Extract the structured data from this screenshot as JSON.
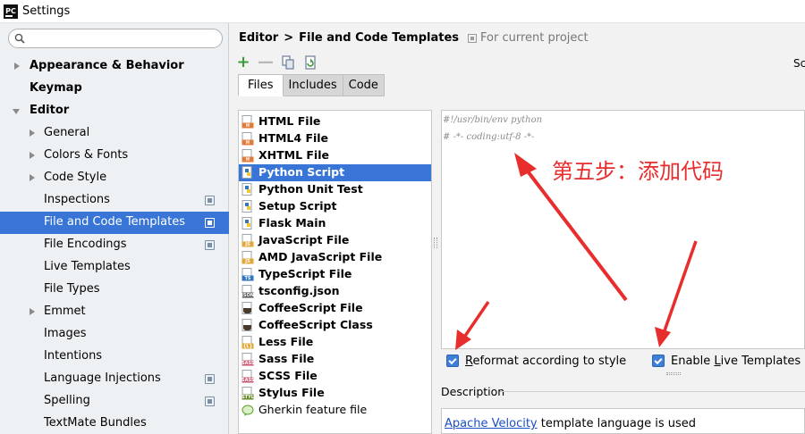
{
  "window": {
    "title": "Settings",
    "app_icon_text": "PC"
  },
  "search": {
    "placeholder": "",
    "value": ""
  },
  "sidebar": {
    "items": [
      {
        "label": "Appearance & Behavior",
        "bold": true
      },
      {
        "label": "Keymap",
        "bold": true
      },
      {
        "label": "Editor",
        "bold": true
      },
      {
        "label": "General"
      },
      {
        "label": "Colors & Fonts"
      },
      {
        "label": "Code Style"
      },
      {
        "label": "Inspections"
      },
      {
        "label": "File and Code Templates",
        "selected": true
      },
      {
        "label": "File Encodings"
      },
      {
        "label": "Live Templates"
      },
      {
        "label": "File Types"
      },
      {
        "label": "Emmet"
      },
      {
        "label": "Images"
      },
      {
        "label": "Intentions"
      },
      {
        "label": "Language Injections"
      },
      {
        "label": "Spelling"
      },
      {
        "label": "TextMate Bundles"
      }
    ]
  },
  "breadcrumb": {
    "parent": "Editor",
    "separator": ">",
    "current": "File and Code Templates",
    "scope": "For current project"
  },
  "toolbar": {
    "right_label": "Sc"
  },
  "tabs": [
    {
      "label": "Files",
      "active": true
    },
    {
      "label": "Includes"
    },
    {
      "label": "Code"
    }
  ],
  "templates": [
    {
      "label": "HTML File",
      "icon": "html-file-icon",
      "badge": "H"
    },
    {
      "label": "HTML4 File",
      "icon": "html-file-icon",
      "badge": "H"
    },
    {
      "label": "XHTML File",
      "icon": "html-file-icon",
      "badge": "H"
    },
    {
      "label": "Python Script",
      "icon": "python-file-icon",
      "selected": true
    },
    {
      "label": "Python Unit Test",
      "icon": "python-file-icon"
    },
    {
      "label": "Setup Script",
      "icon": "python-file-icon"
    },
    {
      "label": "Flask Main",
      "icon": "python-file-icon"
    },
    {
      "label": "JavaScript File",
      "icon": "javascript-file-icon",
      "badge": "JS"
    },
    {
      "label": "AMD JavaScript File",
      "icon": "javascript-file-icon",
      "badge": "JS"
    },
    {
      "label": "TypeScript File",
      "icon": "typescript-file-icon",
      "badge": "TS"
    },
    {
      "label": "tsconfig.json",
      "icon": "json-file-icon",
      "badge": "JSON"
    },
    {
      "label": "CoffeeScript File",
      "icon": "coffee-file-icon"
    },
    {
      "label": "CoffeeScript Class",
      "icon": "coffee-file-icon"
    },
    {
      "label": "Less File",
      "icon": "less-file-icon",
      "badge": "{L}"
    },
    {
      "label": "Sass File",
      "icon": "sass-file-icon",
      "badge": "SASS"
    },
    {
      "label": "SCSS File",
      "icon": "sass-file-icon",
      "badge": "SASS"
    },
    {
      "label": "Stylus File",
      "icon": "stylus-file-icon",
      "badge": "STYL"
    },
    {
      "label": "Gherkin feature file",
      "icon": "gherkin-file-icon",
      "normal": true
    }
  ],
  "editor": {
    "lines": [
      "#!/usr/bin/env python",
      "# -*- coding:utf-8 -*-"
    ]
  },
  "annotation": {
    "text": "第五步：添加代码",
    "color": "#e82d2d"
  },
  "options": {
    "reformat": {
      "label_pre": "",
      "label_underline": "R",
      "label_post": "eformat according to style",
      "checked": true
    },
    "live_templates": {
      "label_pre": "Enable ",
      "label_underline": "L",
      "label_post": "ive Templates",
      "checked": true
    }
  },
  "description": {
    "heading": "Description",
    "link": "Apache Velocity",
    "text": " template language is used"
  },
  "colors": {
    "selection": "#3875d6",
    "accent_green": "#3d9a3d",
    "annotation_red": "#e82d2d",
    "link": "#1a4fc4"
  }
}
